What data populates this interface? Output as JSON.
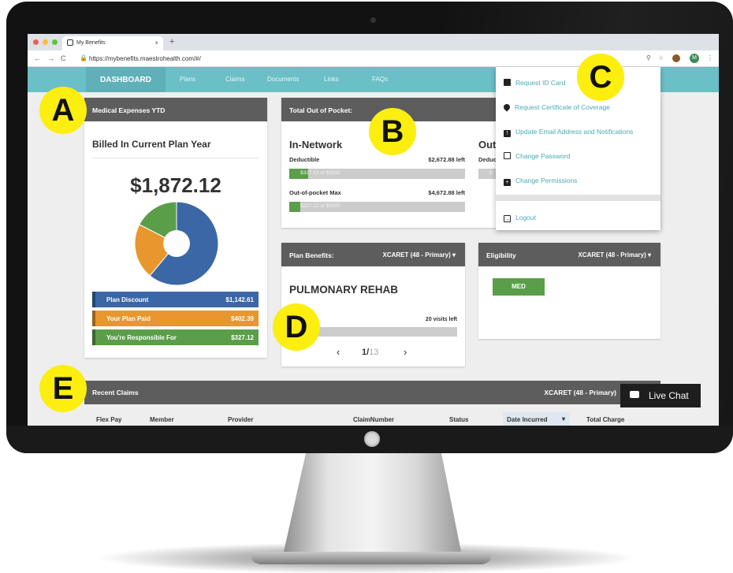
{
  "browser": {
    "tab_title": "My Benefits",
    "tab_close": "×",
    "new_tab": "+",
    "url": "https://mybenefits.maestrohealth.com/#/",
    "avatar_initial": "M"
  },
  "nav": {
    "active": "DASHBOARD",
    "items": [
      "Plans",
      "Claims",
      "Documents",
      "Links",
      "FAQs"
    ]
  },
  "medical": {
    "header": "Medical Expenses YTD",
    "subtitle": "Billed In Current Plan Year",
    "total": "$1,872.12",
    "legend": [
      {
        "label": "Plan Discount",
        "value": "$1,142.61",
        "color": "#3b67a6"
      },
      {
        "label": "Your Plan Paid",
        "value": "$402.39",
        "color": "#e8962e"
      },
      {
        "label": "You're Responsible For",
        "value": "$327.12",
        "color": "#5b9e4a"
      }
    ]
  },
  "oop": {
    "header": "Total Out of Pocket:",
    "in_network_title": "In-Network",
    "out_title": "Out",
    "deductible_label": "Deductible",
    "deductible_left": "$2,672.88 left",
    "deductible_bar": "$327.12 of $3000",
    "deductible_fraction": 0.109,
    "out_deductible_label": "Deduc",
    "out_bar_fragment": "$",
    "max_label": "Out-of-pocket Max",
    "max_left": "$4,672.88 left",
    "max_bar": "$327.12 of $5000",
    "max_fraction": 0.065
  },
  "account_menu": {
    "items": [
      {
        "label": "Request ID Card",
        "icon": "id-card-icon"
      },
      {
        "label": "Request Certificate of Coverage",
        "icon": "location-pin-icon"
      },
      {
        "label": "Update Email Address and Notifications",
        "icon": "alert-message-icon"
      },
      {
        "label": "Change Password",
        "icon": "lock-icon"
      },
      {
        "label": "Change Permissions",
        "icon": "permissions-icon"
      }
    ],
    "logout": "Logout"
  },
  "plan_benefits": {
    "header": "Plan Benefits:",
    "selector": "XCARET (48 - Primary)",
    "title": "PULMONARY REHAB",
    "visits_left": "20 visits left",
    "page_current": "1",
    "page_sep": "/",
    "page_total": "13"
  },
  "eligibility": {
    "header": "Eligibility",
    "selector": "XCARET (48 - Primary)",
    "badge": "MED"
  },
  "claims": {
    "header": "Recent Claims",
    "selector": "XCARET (48 - Primary)",
    "columns": [
      "Flex Pay",
      "Member",
      "Provider",
      "ClaimNumber",
      "Status",
      "Date Incurred",
      "Total Charge"
    ]
  },
  "badges": [
    "A",
    "B",
    "C",
    "D",
    "E"
  ],
  "live_chat": "Live Chat",
  "chart_data": {
    "type": "pie",
    "title": "",
    "categories": [
      "Plan Discount",
      "Your Plan Paid",
      "You're Responsible For"
    ],
    "values": [
      1142.61,
      402.39,
      327.12
    ],
    "colors": [
      "#3b67a6",
      "#e8962e",
      "#5b9e4a"
    ],
    "donut": true
  }
}
